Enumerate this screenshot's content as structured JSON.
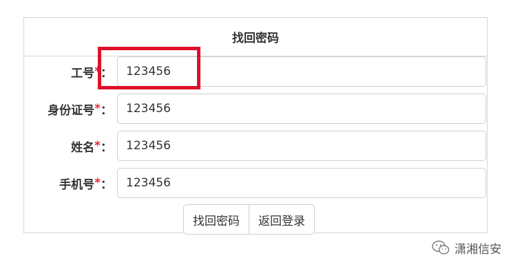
{
  "panel": {
    "title": "找回密码"
  },
  "form": {
    "required_mark": "*",
    "label_colon": "：",
    "fields": [
      {
        "label": "工号",
        "value": "123456"
      },
      {
        "label": "身份证号",
        "value": "123456"
      },
      {
        "label": "姓名",
        "value": "123456"
      },
      {
        "label": "手机号",
        "value": "123456"
      }
    ]
  },
  "buttons": {
    "recover_label": "找回密码",
    "back_label": "返回登录"
  },
  "watermark": {
    "text": "潇湘信安",
    "icon": "wechat-icon"
  },
  "colors": {
    "highlight": "#e0102a",
    "required": "#e23"
  }
}
